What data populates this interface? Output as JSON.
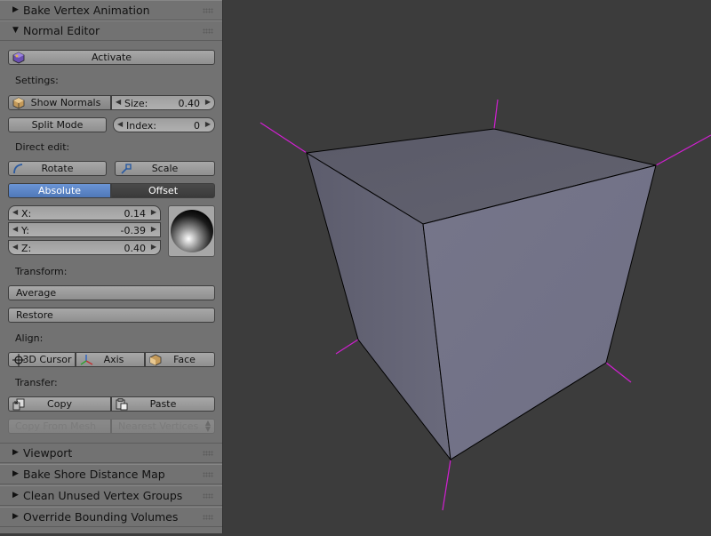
{
  "panels": {
    "bake_vertex_animation": "Bake Vertex Animation",
    "normal_editor": "Normal Editor",
    "viewport": "Viewport",
    "bake_shore_distance_map": "Bake Shore Distance Map",
    "clean_unused_vertex_groups": "Clean Unused Vertex Groups",
    "override_bounding_volumes": "Override Bounding Volumes"
  },
  "normal_editor": {
    "activate": "Activate",
    "settings_label": "Settings:",
    "show_normals": "Show Normals",
    "size_label": "Size:",
    "size_value": "0.40",
    "split_mode": "Split Mode",
    "index_label": "Index:",
    "index_value": "0",
    "direct_edit_label": "Direct edit:",
    "rotate": "Rotate",
    "scale": "Scale",
    "absolute": "Absolute",
    "offset": "Offset",
    "vector": {
      "x_label": "X:",
      "x_value": "0.14",
      "y_label": "Y:",
      "y_value": "-0.39",
      "z_label": "Z:",
      "z_value": "0.40"
    },
    "transform_label": "Transform:",
    "average": "Average",
    "restore": "Restore",
    "align_label": "Align:",
    "cursor_3d": "3D Cursor",
    "axis": "Axis",
    "face": "Face",
    "transfer_label": "Transfer:",
    "copy": "Copy",
    "paste": "Paste",
    "copy_from_mesh": "Copy From Mesh",
    "nearest_vertices": "Nearest Vertices"
  },
  "icons": {
    "activate": "cube-purple-icon",
    "show_normals": "cube-icon",
    "rotate": "rotate-arc-icon",
    "scale": "scale-icon",
    "cursor_3d": "crosshair-icon",
    "axis": "axis-icon",
    "face": "cube-face-icon",
    "copy": "copy-icon",
    "paste": "paste-icon"
  },
  "colors": {
    "panel_bg": "#727272",
    "viewport_bg": "#3c3c3c",
    "toggle_active": "#5680c2",
    "toggle_inactive": "#414141",
    "normal_lines": "#d21fd2"
  }
}
